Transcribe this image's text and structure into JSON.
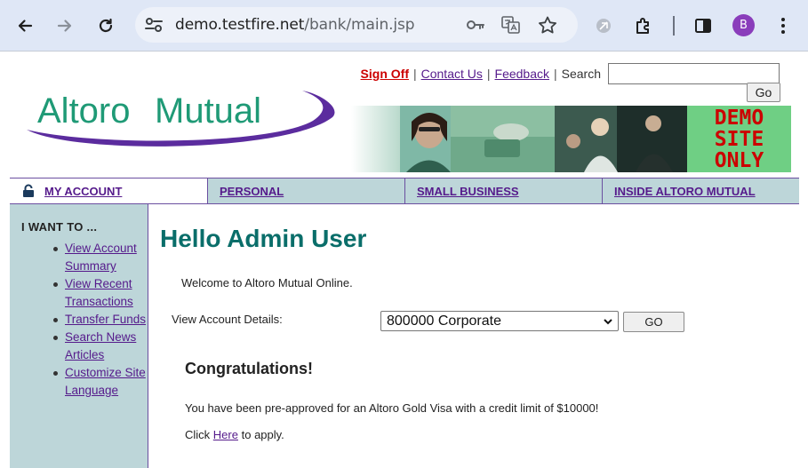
{
  "browser": {
    "url_host": "demo.testfire.net",
    "url_path": "/bank/main.jsp",
    "profile_initial": "B"
  },
  "toplinks": {
    "sign_off": "Sign Off",
    "contact_us": "Contact Us",
    "feedback": "Feedback",
    "search_label": "Search",
    "search_value": "",
    "go": "Go",
    "separator": "|"
  },
  "logo": {
    "part1": "Altoro",
    "part2": "Mutual"
  },
  "banner": {
    "demo_line1": "DEMO",
    "demo_line2": "SITE",
    "demo_line3": "ONLY"
  },
  "tabs": [
    {
      "label": "MY ACCOUNT"
    },
    {
      "label": "PERSONAL"
    },
    {
      "label": "SMALL BUSINESS"
    },
    {
      "label": "INSIDE ALTORO MUTUAL"
    }
  ],
  "sidebar": {
    "heading": "I WANT TO ...",
    "items": [
      {
        "label": "View Account Summary"
      },
      {
        "label": "View Recent Transactions"
      },
      {
        "label": "Transfer Funds"
      },
      {
        "label": "Search News Articles"
      },
      {
        "label": "Customize Site Language"
      }
    ]
  },
  "main": {
    "greeting": "Hello Admin User",
    "welcome": "Welcome to Altoro Mutual Online.",
    "view_details_label": "View Account Details:",
    "account_selected": "800000 Corporate",
    "go_button": "GO",
    "congrats": "Congratulations!",
    "preapproved": "You have been pre-approved for an Altoro Gold Visa with a credit limit of $10000!",
    "click_prefix": "Click",
    "click_link": "Here",
    "click_suffix": "to apply."
  },
  "colors": {
    "heading_teal": "#0a6e6a",
    "nav_bg": "#bdd6d9",
    "link_purple": "#551a8b",
    "sign_off_red": "#cc0000",
    "demo_green": "#6fcf84",
    "logo_green": "#1f9a76",
    "logo_swoosh": "#5b2c9e"
  },
  "icons": {
    "back": "arrow-left-icon",
    "forward": "arrow-right-icon",
    "reload": "reload-icon",
    "site_info": "tune-icon",
    "password": "key-icon",
    "translate": "translate-icon",
    "bookmark": "star-icon",
    "extension": "puzzle-icon",
    "side_panel": "side-panel-icon",
    "menu": "kebab-menu-icon",
    "lock": "lock-icon"
  }
}
